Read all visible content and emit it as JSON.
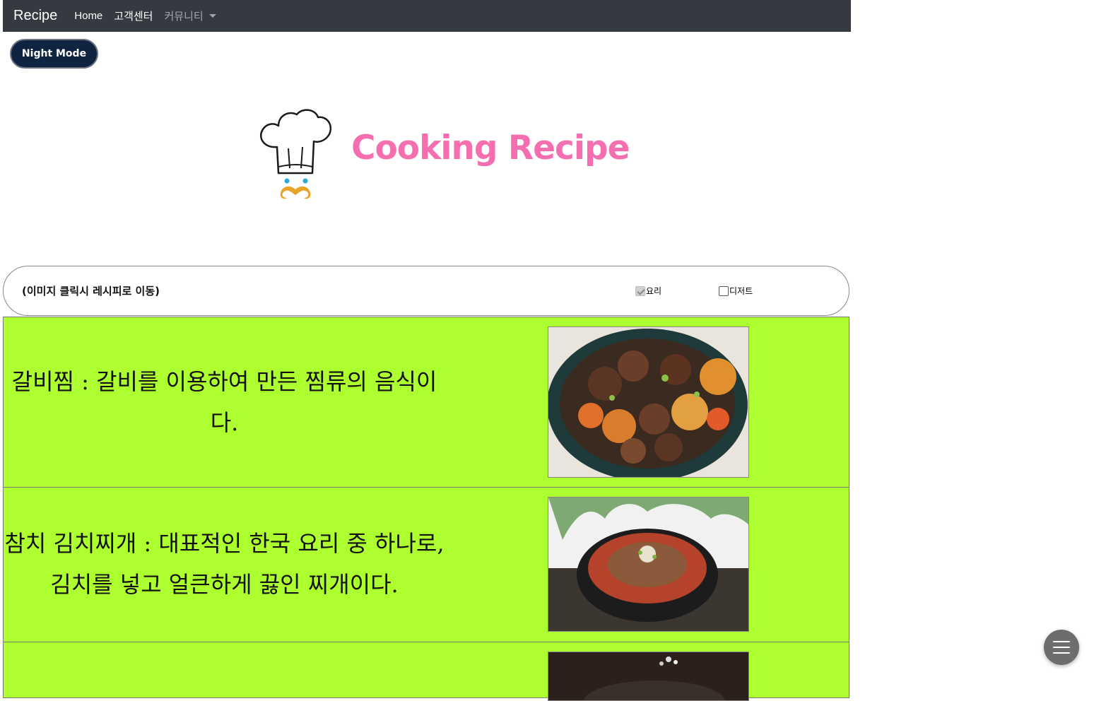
{
  "navbar": {
    "brand": "Recipe",
    "links": [
      {
        "label": "Home"
      },
      {
        "label": "고객센터"
      },
      {
        "label": "커뮤니티"
      }
    ]
  },
  "night_mode_button": "Night Mode",
  "logo": {
    "title": "Cooking Recipe",
    "icon": "chef-hat-mustache-icon"
  },
  "filter": {
    "hint": "(이미지 클릭시 레시피로 이동)",
    "options": [
      {
        "label": "요리",
        "checked": true
      },
      {
        "label": "디저트",
        "checked": false
      }
    ]
  },
  "recipes": [
    {
      "text": "갈비찜 : 갈비를 이용하여 만든 찜류의 음식이다.",
      "image": "galbijjim-photo"
    },
    {
      "text": "참치 김치찌개 : 대표적인 한국 요리 중 하나로, 김치를 넣고 얼큰하게 끓인 찌개이다.",
      "image": "kimchi-jjigae-photo"
    },
    {
      "text": "",
      "image": "dish-photo"
    }
  ],
  "colors": {
    "navbar": "#343a40",
    "row_bg": "#adff2f",
    "logo_text": "#f56fb0",
    "night_btn": "#0f2440"
  },
  "fab_icon": "hamburger-menu-icon"
}
